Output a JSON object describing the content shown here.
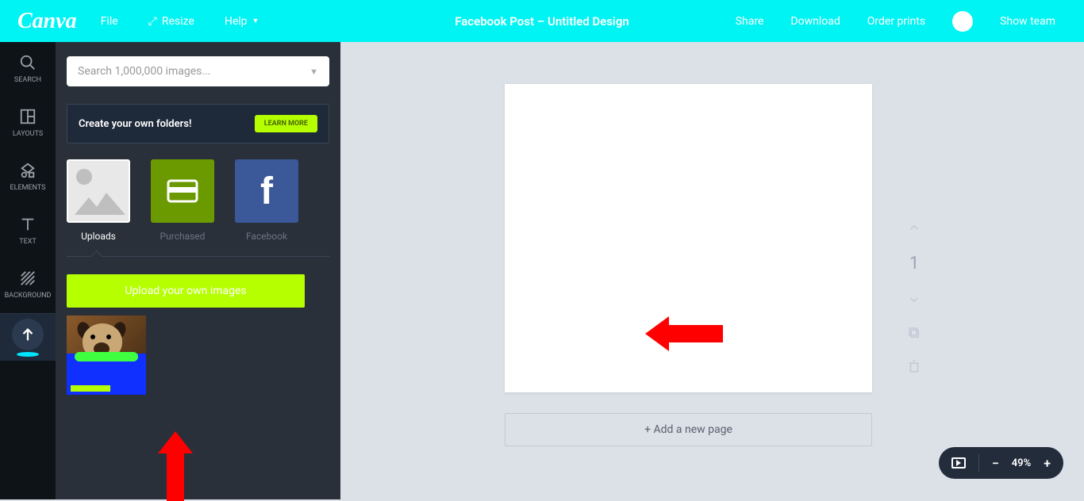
{
  "topbar": {
    "logo": "Canva",
    "file": "File",
    "resize": "Resize",
    "help": "Help",
    "title": "Facebook Post – Untitled Design",
    "share": "Share",
    "download": "Download",
    "order_prints": "Order prints",
    "show_team": "Show team"
  },
  "iconbar": {
    "search": "SEARCH",
    "layouts": "LAYOUTS",
    "elements": "ELEMENTS",
    "text": "TEXT",
    "background": "BACKGROUND"
  },
  "panel": {
    "search_placeholder": "Search 1,000,000 images...",
    "folders_banner": "Create your own folders!",
    "learn_more": "LEARN MORE",
    "categories": {
      "uploads": "Uploads",
      "purchased": "Purchased",
      "facebook": "Facebook"
    },
    "upload_button": "Upload your own images"
  },
  "canvas": {
    "page_number": "1",
    "add_page": "+ Add a new page"
  },
  "zoom": {
    "minus": "−",
    "value": "49%",
    "plus": "+"
  },
  "colors": {
    "accent_cyan": "#00f4f4",
    "accent_lime": "#b5ff00",
    "panel_bg": "#293039",
    "annotation_red": "#ff0000"
  }
}
